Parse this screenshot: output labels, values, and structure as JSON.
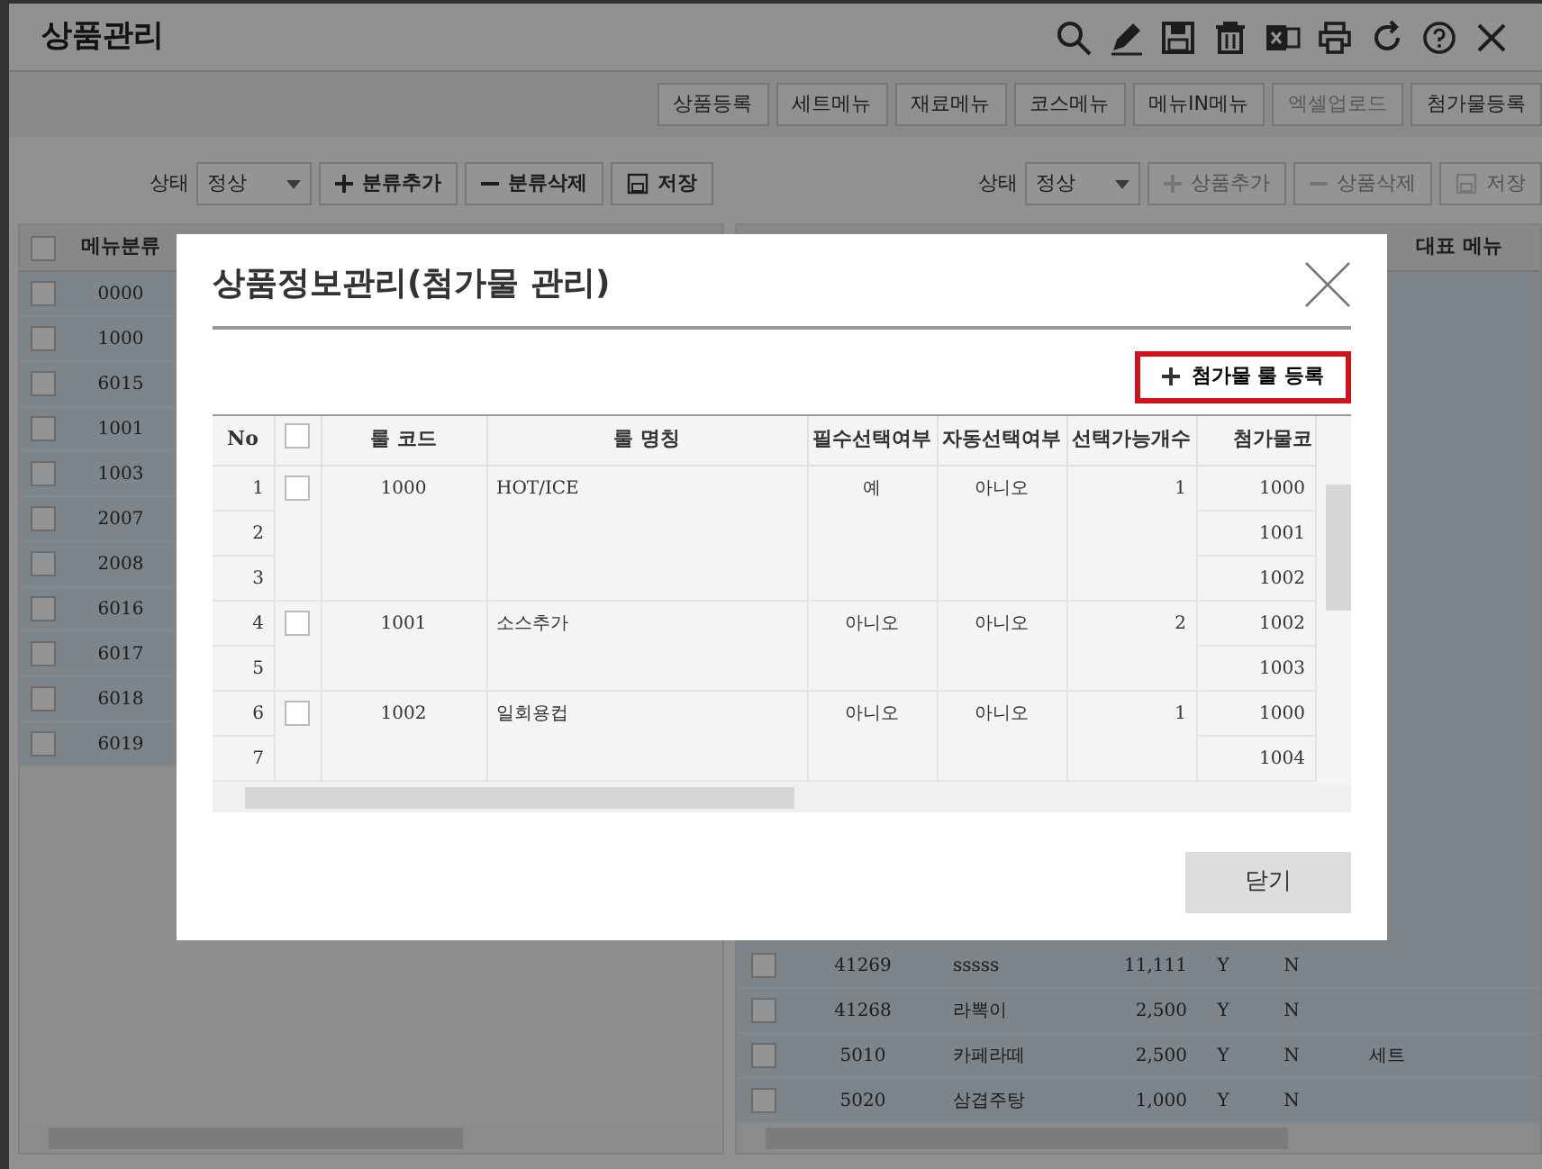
{
  "window": {
    "title": "상품관리"
  },
  "tabs": [
    {
      "label": "상품등록",
      "disabled": false
    },
    {
      "label": "세트메뉴",
      "disabled": false
    },
    {
      "label": "재료메뉴",
      "disabled": false
    },
    {
      "label": "코스메뉴",
      "disabled": false
    },
    {
      "label": "메뉴IN메뉴",
      "disabled": false
    },
    {
      "label": "엑셀업로드",
      "disabled": true
    },
    {
      "label": "첨가물등록",
      "disabled": false
    }
  ],
  "left_panel": {
    "status_label": "상태",
    "status_value": "정상",
    "buttons": [
      {
        "label": "분류추가",
        "kind": "add",
        "disabled": false
      },
      {
        "label": "분류삭제",
        "kind": "remove",
        "disabled": false
      },
      {
        "label": "저장",
        "kind": "save",
        "disabled": false
      }
    ],
    "table": {
      "header_checked": false,
      "column_1": "메뉴분류",
      "rows": [
        {
          "code": "0000",
          "checked": false
        },
        {
          "code": "1000",
          "checked": false
        },
        {
          "code": "6015",
          "checked": false
        },
        {
          "code": "1001",
          "checked": false
        },
        {
          "code": "1003",
          "checked": false
        },
        {
          "code": "2007",
          "checked": false
        },
        {
          "code": "2008",
          "checked": false
        },
        {
          "code": "6016",
          "checked": false
        },
        {
          "code": "6017",
          "checked": false
        },
        {
          "code": "6018",
          "checked": false
        },
        {
          "code": "6019",
          "checked": false
        }
      ]
    }
  },
  "right_panel": {
    "status_label": "상태",
    "status_value": "정상",
    "buttons": [
      {
        "label": "상품추가",
        "kind": "add",
        "disabled": true
      },
      {
        "label": "상품삭제",
        "kind": "remove",
        "disabled": true
      },
      {
        "label": "저장",
        "kind": "save",
        "disabled": true
      }
    ],
    "table": {
      "column_header": "대표 메뉴",
      "rows": [
        {
          "checked": false,
          "code": "41269",
          "name": "sssss",
          "price": "11,111",
          "column_5": "Y",
          "column_6": "N"
        },
        {
          "checked": false,
          "code": "41268",
          "name": "라뽁이",
          "price": "2,500",
          "column_5": "Y",
          "column_6": "N"
        },
        {
          "checked": false,
          "code": "5010",
          "name": "카페라떼",
          "price": "2,500",
          "column_5": "Y",
          "column_6": "N",
          "rep": "세트"
        },
        {
          "checked": false,
          "code": "5020",
          "name": "삼겹주탕",
          "price": "1,000",
          "column_5": "Y",
          "column_6": "N"
        }
      ]
    }
  },
  "dialog": {
    "title": "상품정보관리(첨가물 관리)",
    "add_button": {
      "label": "첨가물 룰 등록",
      "highlighted": true
    },
    "columns": [
      "No",
      "룰 코드",
      "룰 명칭",
      "필수선택여부",
      "자동선택여부",
      "선택가능개수",
      "첨가물코"
    ],
    "header_checked": false,
    "rules": [
      {
        "checked": false,
        "code": "1000",
        "name": "HOT/ICE",
        "required": "예",
        "auto": "아니오",
        "count": "1",
        "items": [
          {
            "no": "1",
            "addon": "1000"
          },
          {
            "no": "2",
            "addon": "1001"
          },
          {
            "no": "3",
            "addon": "1002"
          }
        ]
      },
      {
        "checked": false,
        "code": "1001",
        "name": "소스추가",
        "required": "아니오",
        "auto": "아니오",
        "count": "2",
        "items": [
          {
            "no": "4",
            "addon": "1002"
          },
          {
            "no": "5",
            "addon": "1003"
          }
        ]
      },
      {
        "checked": false,
        "code": "1002",
        "name": "일회용컵",
        "required": "아니오",
        "auto": "아니오",
        "count": "1",
        "items": [
          {
            "no": "6",
            "addon": "1000"
          },
          {
            "no": "7",
            "addon": "1004"
          }
        ]
      }
    ],
    "close_button": "닫기"
  }
}
